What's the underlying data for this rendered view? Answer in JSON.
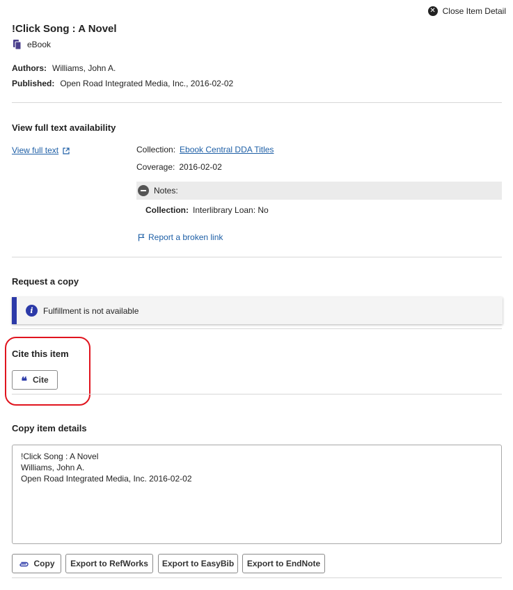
{
  "header": {
    "close_label": "Close Item Detail"
  },
  "item": {
    "title": "!Click Song : A Novel",
    "format": "eBook",
    "authors_label": "Authors:",
    "authors_value": "Williams, John A.",
    "published_label": "Published:",
    "published_value": "Open Road Integrated Media, Inc., 2016-02-02"
  },
  "fulltext": {
    "heading": "View full text availability",
    "link_label": "View full text",
    "collection_label": "Collection:",
    "collection_value": "Ebook Central DDA Titles",
    "coverage_label": "Coverage:",
    "coverage_value": "2016-02-02",
    "notes_label": "Notes:",
    "note_collection_label": "Collection:",
    "note_collection_value": "Interlibrary Loan: No",
    "report_label": "Report a broken link"
  },
  "request": {
    "heading": "Request a copy",
    "message": "Fulfillment is not available"
  },
  "cite": {
    "heading": "Cite this item",
    "button_label": "Cite"
  },
  "copy_details": {
    "heading": "Copy item details",
    "text": "!Click Song : A Novel\nWilliams, John A.\nOpen Road Integrated Media, Inc. 2016-02-02",
    "copy_label": "Copy",
    "refworks_label": "Export to RefWorks",
    "easybib_label": "Export to EasyBib",
    "endnote_label": "Export to EndNote"
  },
  "colors": {
    "accent": "#2c3aa8",
    "link": "#1e5fa6",
    "highlight": "#e0141e"
  }
}
